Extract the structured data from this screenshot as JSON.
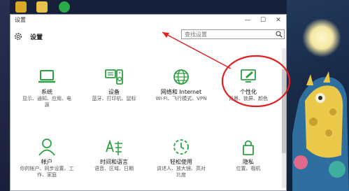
{
  "window": {
    "title": "设置"
  },
  "header": {
    "title": "设置",
    "search_placeholder": "查找设置"
  },
  "tiles": [
    {
      "name": "系统",
      "desc": "显示、通知、应用、电\n源",
      "icon": "laptop-icon"
    },
    {
      "name": "设备",
      "desc": "蓝牙、打印机、鼠标",
      "icon": "keyboard-speaker-icon"
    },
    {
      "name": "网络和 Internet",
      "desc": "Wi-Fi、飞行模式、VPN",
      "icon": "globe-icon"
    },
    {
      "name": "个性化",
      "desc": "背景、锁屏、颜色",
      "icon": "paint-monitor-icon"
    },
    {
      "name": "帐户",
      "desc": "你的帐户、同步设置、工\n作、家庭",
      "icon": "person-icon"
    },
    {
      "name": "时间和语言",
      "desc": "语音、区域、日期",
      "icon": "time-language-icon"
    },
    {
      "name": "轻松使用",
      "desc": "讲述人、放大镜、高对\n比度",
      "icon": "ease-of-access-icon"
    },
    {
      "name": "隐私",
      "desc": "位置、相机",
      "icon": "lock-icon"
    }
  ],
  "colors": {
    "accent": "#2ea043",
    "annotation": "#e02020"
  }
}
